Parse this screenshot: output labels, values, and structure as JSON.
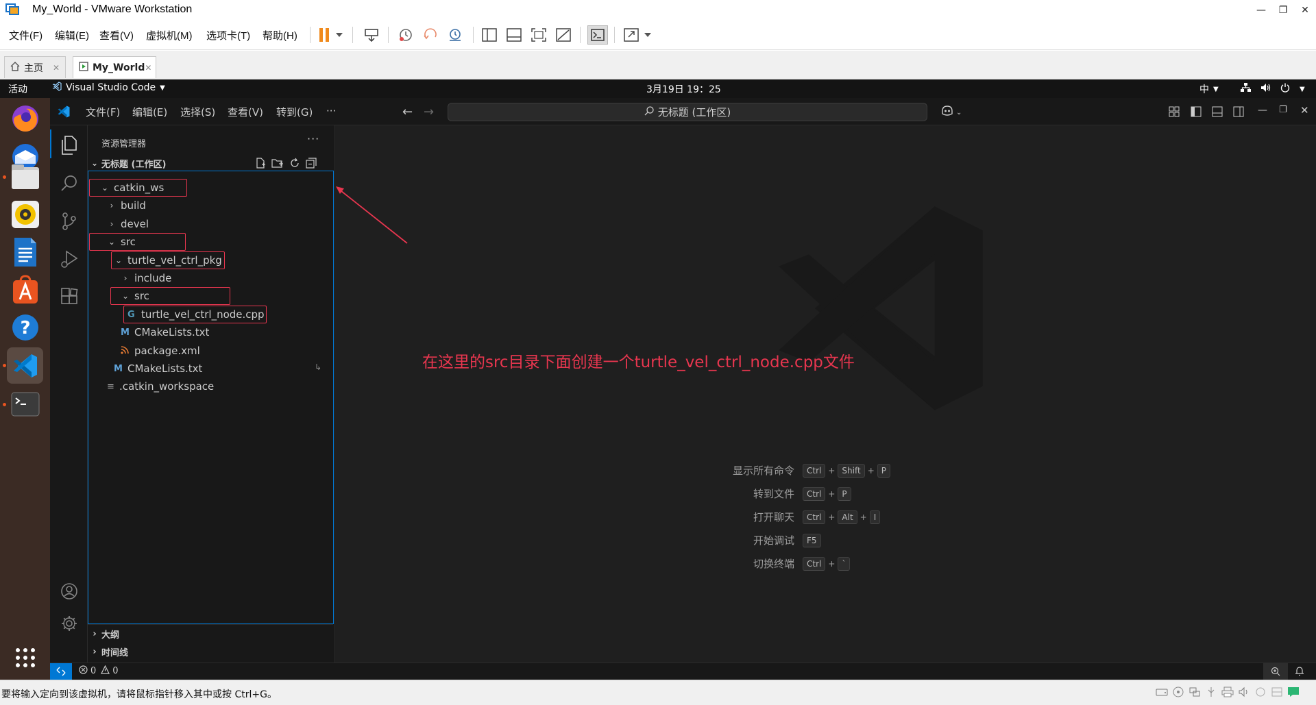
{
  "vm": {
    "window_title": "My_World - VMware Workstation",
    "menus": [
      "文件(F)",
      "编辑(E)",
      "查看(V)",
      "虚拟机(M)",
      "选项卡(T)",
      "帮助(H)"
    ],
    "tabs": [
      {
        "label": "主页"
      },
      {
        "label": "My_World"
      }
    ],
    "status_text": "要将输入定向到该虚拟机，请将鼠标指针移入其中或按 Ctrl+G。"
  },
  "ubuntu": {
    "activities": "活动",
    "app_name": "Visual Studio Code",
    "datetime": "3月19日  19：25",
    "input_method": "中"
  },
  "vscode": {
    "menus": [
      "文件(F)",
      "编辑(E)",
      "选择(S)",
      "查看(V)",
      "转到(G)",
      "···"
    ],
    "command_center": "无标题 (工作区)",
    "explorer": {
      "title": "资源管理器",
      "workspace": "无标题 (工作区)",
      "tree": [
        {
          "label": "catkin_ws",
          "type": "folder-open"
        },
        {
          "label": "build",
          "type": "folder"
        },
        {
          "label": "devel",
          "type": "folder"
        },
        {
          "label": "src",
          "type": "folder-open"
        },
        {
          "label": "turtle_vel_ctrl_pkg",
          "type": "folder-open"
        },
        {
          "label": "include",
          "type": "folder"
        },
        {
          "label": "src",
          "type": "folder-open"
        },
        {
          "label": "turtle_vel_ctrl_node.cpp",
          "type": "cpp-file"
        },
        {
          "label": "CMakeLists.txt",
          "type": "cmake-file"
        },
        {
          "label": "package.xml",
          "type": "xml-file"
        },
        {
          "label": "CMakeLists.txt",
          "type": "cmake-file"
        },
        {
          "label": ".catkin_workspace",
          "type": "text-file"
        }
      ],
      "outline": "大纲",
      "timeline": "时间线"
    },
    "annotation": "在这里的src目录下面创建一个turtle_vel_ctrl_node.cpp文件",
    "shortcuts": [
      {
        "label": "显示所有命令",
        "keys": [
          "Ctrl",
          "Shift",
          "P"
        ]
      },
      {
        "label": "转到文件",
        "keys": [
          "Ctrl",
          "P"
        ]
      },
      {
        "label": "打开聊天",
        "keys": [
          "Ctrl",
          "Alt",
          "I"
        ]
      },
      {
        "label": "开始调试",
        "keys": [
          "F5"
        ]
      },
      {
        "label": "切换终端",
        "keys": [
          "Ctrl",
          "`"
        ]
      }
    ],
    "status": {
      "errors": "0",
      "warnings": "0"
    }
  },
  "colors": {
    "annotation_red": "#e8364f",
    "vscode_bg": "#1f1f1f",
    "vscode_accent": "#0078d4",
    "dock_bg": "#3b2b24"
  }
}
